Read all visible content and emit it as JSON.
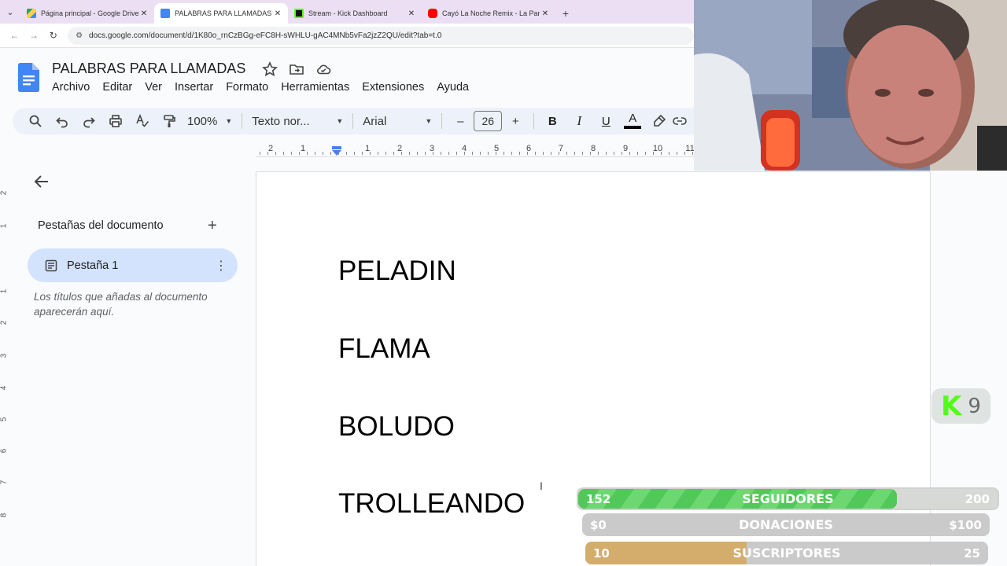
{
  "browser": {
    "tabs": [
      {
        "title": "Página principal - Google Drive",
        "color": "#1fa463"
      },
      {
        "title": "PALABRAS PARA LLAMADAS - Documentos de Google",
        "color": "#4285f4"
      },
      {
        "title": "Stream - Kick Dashboard",
        "color": "#53fc18"
      },
      {
        "title": "Cayó La Noche Remix - La Pantera, Quevedo",
        "color": "#ff0000"
      }
    ],
    "url": "docs.google.com/document/d/1K80o_rnCzBGg-eFC8H-sWHLU-gAC4MNb5vFa2jzZ2QU/edit?tab=t.0"
  },
  "doc": {
    "title": "PALABRAS PARA LLAMADAS",
    "menu": [
      "Archivo",
      "Editar",
      "Ver",
      "Insertar",
      "Formato",
      "Herramientas",
      "Extensiones",
      "Ayuda"
    ]
  },
  "toolbar": {
    "zoom": "100%",
    "style": "Texto nor...",
    "font": "Arial",
    "font_size": "26",
    "minus": "–",
    "plus": "+"
  },
  "ruler": {
    "numbers": [
      "2",
      "1",
      "1",
      "2",
      "3",
      "4",
      "5",
      "6",
      "7",
      "8",
      "9",
      "10",
      "11"
    ]
  },
  "vruler": {
    "numbers": [
      "2",
      "1",
      "1",
      "2",
      "3",
      "4",
      "5",
      "6",
      "7",
      "8"
    ]
  },
  "sidebar": {
    "heading": "Pestañas del documento",
    "tab_label": "Pestaña 1",
    "hint": "Los títulos que añadas al documento aparecerán aquí."
  },
  "page": {
    "lines": [
      "PELADIN",
      "FLAMA",
      "BOLUDO",
      "TROLLEANDO"
    ]
  },
  "overlay": {
    "kick_logo": "K",
    "kick_count": "9",
    "goals": [
      {
        "current": "152",
        "label": "SEGUIDORES",
        "target": "200",
        "progress": 0.76
      },
      {
        "current": "$0",
        "label": "DONACIONES",
        "target": "$100",
        "progress": 0.0
      },
      {
        "current": "10",
        "label": "SUSCRIPTORES",
        "target": "25",
        "progress": 0.4
      }
    ]
  }
}
